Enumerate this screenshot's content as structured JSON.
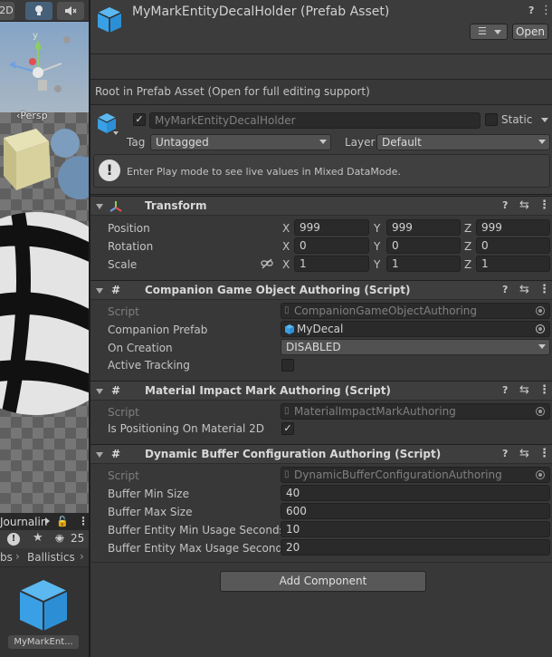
{
  "left_panel": {
    "scene_toolbar": {
      "mode_2d": "2D"
    },
    "scene_view": {
      "persp_label": "‹Persp"
    },
    "project": {
      "tab_title": "Journalin",
      "hidden_count": "25",
      "breadcrumb_prev": "bs",
      "breadcrumb_current": "Ballistics",
      "asset_name": "MyMarkEnt..."
    }
  },
  "inspector": {
    "header": {
      "title": "MyMarkEntityDecalHolder (Prefab Asset)",
      "help": "?",
      "menu": "⋮",
      "open_label": "Open"
    },
    "info_text": "Root in Prefab Asset (Open for full editing support)",
    "game_object": {
      "active": true,
      "name": "MyMarkEntityDecalHolder",
      "static_label": "Static",
      "tag_label": "Tag",
      "tag_value": "Untagged",
      "layer_label": "Layer",
      "layer_value": "Default",
      "notice_text": "Enter Play mode to see live values in Mixed DataMode."
    },
    "transform": {
      "title": "Transform",
      "position_label": "Position",
      "rotation_label": "Rotation",
      "scale_label": "Scale",
      "axis_x": "X",
      "axis_y": "Y",
      "axis_z": "Z",
      "position": {
        "x": "999",
        "y": "999",
        "z": "999"
      },
      "rotation": {
        "x": "0",
        "y": "0",
        "z": "0"
      },
      "scale": {
        "x": "1",
        "y": "1",
        "z": "1"
      }
    },
    "companion": {
      "title": "Companion Game Object Authoring (Script)",
      "script_label": "Script",
      "script_value": "CompanionGameObjectAuthoring",
      "prefab_label": "Companion Prefab",
      "prefab_value": "MyDecal",
      "on_creation_label": "On Creation",
      "on_creation_value": "DISABLED",
      "active_tracking_label": "Active Tracking",
      "active_tracking_checked": false
    },
    "material_impact": {
      "title": "Material Impact Mark Authoring (Script)",
      "script_label": "Script",
      "script_value": "MaterialImpactMarkAuthoring",
      "positioning_label": "Is Positioning On Material 2D",
      "positioning_checked": true
    },
    "dynamic_buffer": {
      "title": "Dynamic Buffer Configuration Authoring (Script)",
      "script_label": "Script",
      "script_value": "DynamicBufferConfigurationAuthoring",
      "min_size_label": "Buffer Min Size",
      "min_size_value": "40",
      "max_size_label": "Buffer Max Size",
      "max_size_value": "600",
      "min_usage_label": "Buffer Entity Min Usage Seconds",
      "min_usage_value": "10",
      "max_usage_label": "Buffer Entity Max Usage Seconds",
      "max_usage_value": "20"
    },
    "add_component_label": "Add Component"
  }
}
